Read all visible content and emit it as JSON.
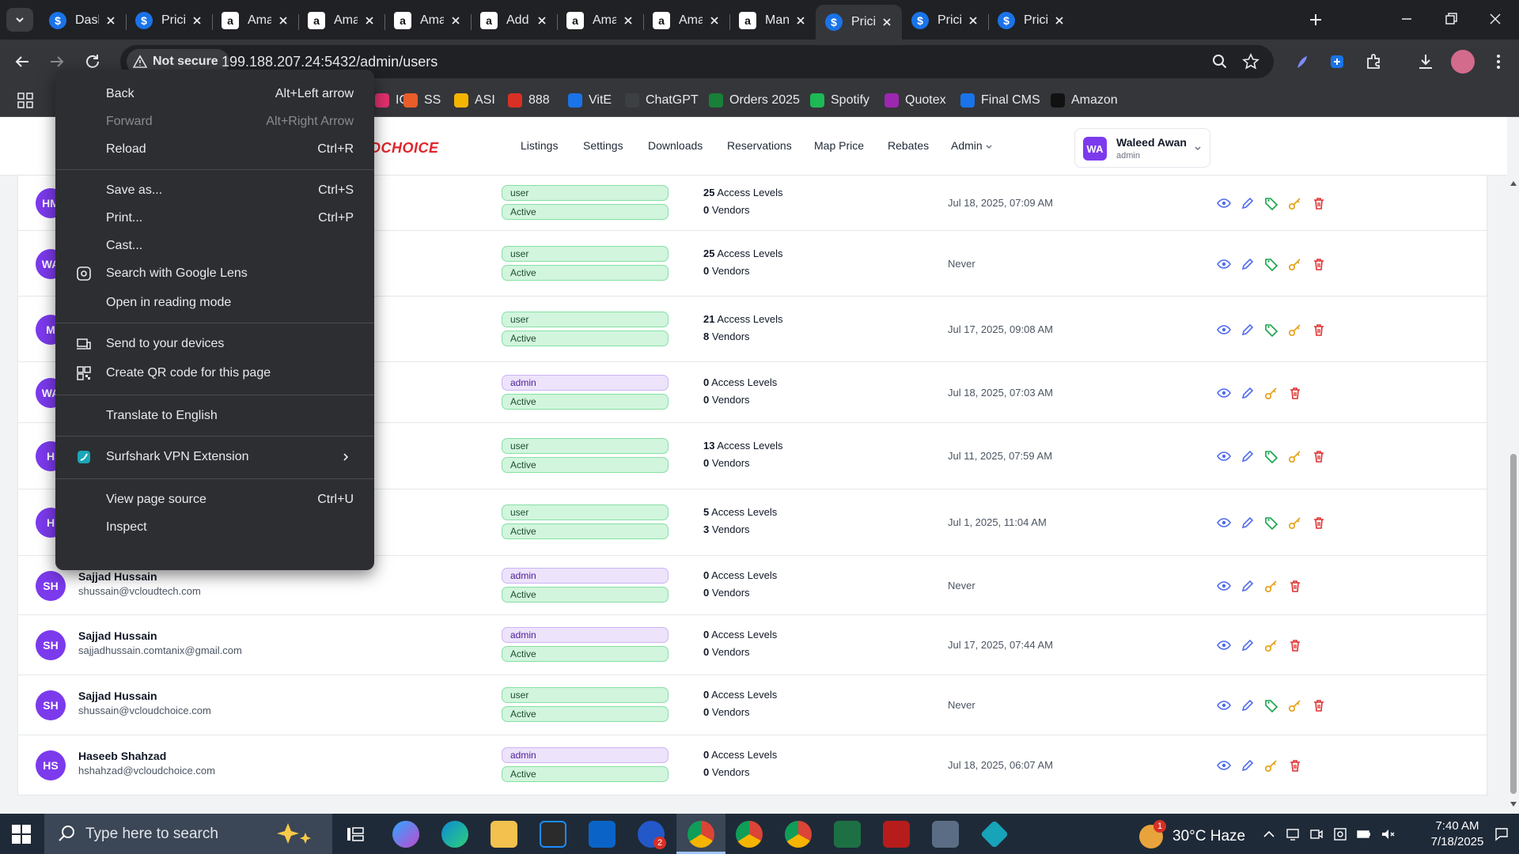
{
  "browser": {
    "tabs": [
      {
        "title": "Dashb",
        "icon": "dollar"
      },
      {
        "title": "Pricing",
        "icon": "dollar"
      },
      {
        "title": "Amazo",
        "icon": "amazon"
      },
      {
        "title": "Amazo",
        "icon": "amazon"
      },
      {
        "title": "Amazo",
        "icon": "amazon"
      },
      {
        "title": "Add Pr",
        "icon": "amazon"
      },
      {
        "title": "Amazo",
        "icon": "amazon"
      },
      {
        "title": "Amazo",
        "icon": "amazon"
      },
      {
        "title": "Manag",
        "icon": "amazon"
      },
      {
        "title": "Pricing",
        "icon": "dollar",
        "active": true
      },
      {
        "title": "Pricing",
        "icon": "dollar"
      },
      {
        "title": "Pricing",
        "icon": "dollar"
      }
    ],
    "security_label": "Not secure",
    "url": "199.188.207.24:5432/admin/users",
    "bookmarks": [
      {
        "label": "IG",
        "color": "#e1306c"
      },
      {
        "label": "SS",
        "color": "#e85d2a"
      },
      {
        "label": "ASI",
        "color": "#f4b400"
      },
      {
        "label": "888",
        "color": "#d93025"
      },
      {
        "label": "VitE",
        "color": "#1a73e8"
      },
      {
        "label": "ChatGPT",
        "color": "#3c4043"
      },
      {
        "label": "Orders 2025",
        "color": "#188038"
      },
      {
        "label": "Spotify",
        "color": "#1db954"
      },
      {
        "label": "Quotex",
        "color": "#9c27b0"
      },
      {
        "label": "Final CMS",
        "color": "#1a73e8"
      },
      {
        "label": "Amazon",
        "color": "#111111"
      }
    ]
  },
  "app": {
    "logo_text": "DCHOICE",
    "nav": [
      "Listings",
      "Settings",
      "Downloads",
      "Reservations",
      "Map Price",
      "Rebates",
      "Admin"
    ],
    "user": {
      "initials": "WA",
      "name": "Waleed Awan",
      "role": "admin"
    }
  },
  "users": [
    {
      "initials": "HM",
      "name": "",
      "email": "",
      "role": "user",
      "status": "Active",
      "access_count": "25",
      "access_label": "Access Levels",
      "vendor_count": "0",
      "vendor_label": "Vendors",
      "last_login": "Jul 18, 2025, 07:09 AM",
      "has_tag": true
    },
    {
      "initials": "WA",
      "name": "",
      "email": "",
      "role": "user",
      "status": "Active",
      "access_count": "25",
      "access_label": "Access Levels",
      "vendor_count": "0",
      "vendor_label": "Vendors",
      "last_login": "Never",
      "has_tag": true
    },
    {
      "initials": "M",
      "name": "",
      "email": "",
      "role": "user",
      "status": "Active",
      "access_count": "21",
      "access_label": "Access Levels",
      "vendor_count": "8",
      "vendor_label": "Vendors",
      "last_login": "Jul 17, 2025, 09:08 AM",
      "has_tag": true
    },
    {
      "initials": "WA",
      "name": "",
      "email": "",
      "role": "admin",
      "status": "Active",
      "access_count": "0",
      "access_label": "Access Levels",
      "vendor_count": "0",
      "vendor_label": "Vendors",
      "last_login": "Jul 18, 2025, 07:03 AM",
      "has_tag": false
    },
    {
      "initials": "H",
      "name": "",
      "email": "",
      "role": "user",
      "status": "Active",
      "access_count": "13",
      "access_label": "Access Levels",
      "vendor_count": "0",
      "vendor_label": "Vendors",
      "last_login": "Jul 11, 2025, 07:59 AM",
      "has_tag": true
    },
    {
      "initials": "H",
      "name": "",
      "email": "",
      "role": "user",
      "status": "Active",
      "access_count": "5",
      "access_label": "Access Levels",
      "vendor_count": "3",
      "vendor_label": "Vendors",
      "last_login": "Jul 1, 2025, 11:04 AM",
      "has_tag": true
    },
    {
      "initials": "SH",
      "name": "Sajjad Hussain",
      "email": "shussain@vcloudtech.com",
      "role": "admin",
      "status": "Active",
      "access_count": "0",
      "access_label": "Access Levels",
      "vendor_count": "0",
      "vendor_label": "Vendors",
      "last_login": "Never",
      "has_tag": false
    },
    {
      "initials": "SH",
      "name": "Sajjad Hussain",
      "email": "sajjadhussain.comtanix@gmail.com",
      "role": "admin",
      "status": "Active",
      "access_count": "0",
      "access_label": "Access Levels",
      "vendor_count": "0",
      "vendor_label": "Vendors",
      "last_login": "Jul 17, 2025, 07:44 AM",
      "has_tag": false
    },
    {
      "initials": "SH",
      "name": "Sajjad Hussain",
      "email": "shussain@vcloudchoice.com",
      "role": "user",
      "status": "Active",
      "access_count": "0",
      "access_label": "Access Levels",
      "vendor_count": "0",
      "vendor_label": "Vendors",
      "last_login": "Never",
      "has_tag": true
    },
    {
      "initials": "HS",
      "name": "Haseeb Shahzad",
      "email": "hshahzad@vcloudchoice.com",
      "role": "admin",
      "status": "Active",
      "access_count": "0",
      "access_label": "Access Levels",
      "vendor_count": "0",
      "vendor_label": "Vendors",
      "last_login": "Jul 18, 2025, 06:07 AM",
      "has_tag": false
    }
  ],
  "context_menu": {
    "items": [
      {
        "label": "Back",
        "shortcut": "Alt+Left arrow",
        "icon": ""
      },
      {
        "label": "Forward",
        "shortcut": "Alt+Right Arrow",
        "disabled": true,
        "icon": ""
      },
      {
        "label": "Reload",
        "shortcut": "Ctrl+R",
        "icon": ""
      },
      {
        "separator": true
      },
      {
        "label": "Save as...",
        "shortcut": "Ctrl+S",
        "icon": ""
      },
      {
        "label": "Print...",
        "shortcut": "Ctrl+P",
        "icon": ""
      },
      {
        "label": "Cast...",
        "shortcut": "",
        "icon": ""
      },
      {
        "label": "Search with Google Lens",
        "shortcut": "",
        "icon": "lens-icon"
      },
      {
        "label": "Open in reading mode",
        "shortcut": "",
        "icon": ""
      },
      {
        "separator": true
      },
      {
        "label": "Send to your devices",
        "shortcut": "",
        "icon": "devices-icon"
      },
      {
        "label": "Create QR code for this page",
        "shortcut": "",
        "icon": "qr-icon"
      },
      {
        "separator": true
      },
      {
        "label": "Translate to English",
        "shortcut": "",
        "icon": ""
      },
      {
        "separator": true
      },
      {
        "label": "Surfshark VPN Extension",
        "shortcut": "",
        "icon": "surfshark-icon",
        "submenu": true
      },
      {
        "separator": true
      },
      {
        "label": "View page source",
        "shortcut": "Ctrl+U",
        "icon": ""
      },
      {
        "label": "Inspect",
        "shortcut": "",
        "icon": ""
      }
    ]
  },
  "taskbar": {
    "search_placeholder": "Type here to search",
    "weather": "30°C Haze",
    "time": "7:40 AM",
    "date": "7/18/2025",
    "weather_badge": "1",
    "edge_badge": "2"
  },
  "colors": {
    "avatar": "#7c3aed",
    "view": "#4f6bed",
    "edit": "#4f6bed",
    "tag": "#16a34a",
    "key": "#e6a118",
    "delete": "#e03131",
    "logo": "#e0252b"
  }
}
